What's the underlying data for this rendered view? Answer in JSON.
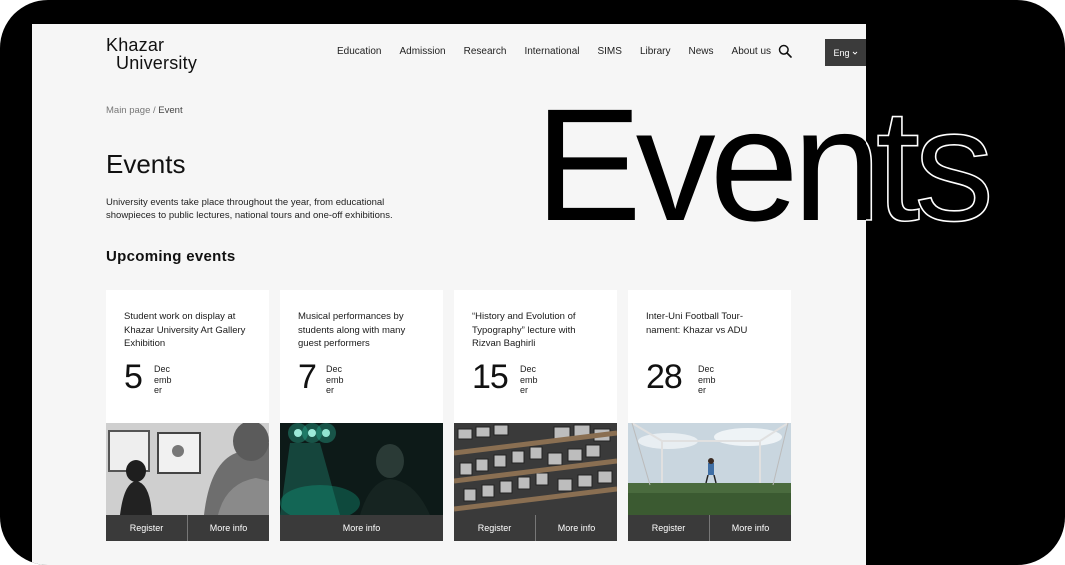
{
  "logo": {
    "line1": "Khazar",
    "line2": "University"
  },
  "nav": [
    {
      "label": "Education",
      "key": "education"
    },
    {
      "label": "Admission",
      "key": "admission"
    },
    {
      "label": "Research",
      "key": "research"
    },
    {
      "label": "International",
      "key": "international"
    },
    {
      "label": "SIMS",
      "key": "sims"
    },
    {
      "label": "Library",
      "key": "library"
    },
    {
      "label": "News",
      "key": "news"
    },
    {
      "label": "About us",
      "key": "about-us"
    }
  ],
  "language": {
    "label": "Eng"
  },
  "breadcrumb": {
    "home": "Main page",
    "separator": " / ",
    "current": "Event"
  },
  "page": {
    "title": "Events",
    "intro": "University events take place throughout the year, from educational showpieces to public lectures, national tours and one-off exhibitions.",
    "section_title": "Upcoming events",
    "hero_text": "Events"
  },
  "events": [
    {
      "title": "Student work on display at Khazar University Art Gallery Exhibition",
      "day": "5",
      "month": "December",
      "buttons": [
        "Register",
        "More info"
      ],
      "image": "gallery-photo"
    },
    {
      "title": "Musical performances by students along with many guest performers",
      "day": "7",
      "month": "December",
      "buttons": [
        "More info"
      ],
      "image": "concert-photo"
    },
    {
      "title": "“History and Evolution of Typography” lecture with Rizvan Baghirli",
      "day": "15",
      "month": "December",
      "buttons": [
        "Register",
        "More info"
      ],
      "image": "typography-photo"
    },
    {
      "title": "Inter-Uni Football Tour-nament: Khazar vs ADU",
      "day": "28",
      "month": "December",
      "buttons": [
        "Register",
        "More info"
      ],
      "image": "football-photo"
    }
  ],
  "icons": {
    "search": "search-icon",
    "lang_caret": "chevron-down-icon"
  },
  "colors": {
    "frame": "#000000",
    "page": "#f6f6f6",
    "button_bar": "#3a3a3a"
  }
}
